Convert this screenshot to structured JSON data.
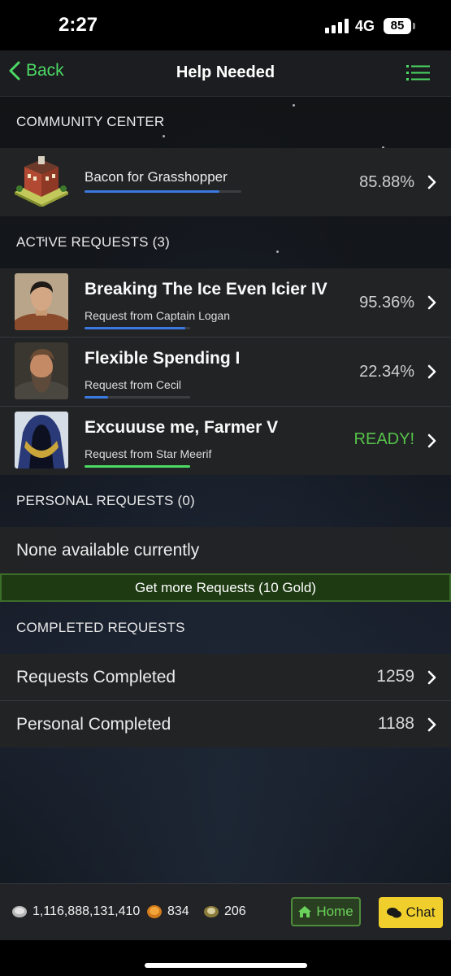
{
  "status_bar": {
    "time": "2:27",
    "network": "4G",
    "battery": "85"
  },
  "nav": {
    "back_label": "Back",
    "title": "Help Needed"
  },
  "community": {
    "section_label": "COMMUNITY CENTER",
    "name": "Bacon for Grasshopper",
    "percent": "85.88%",
    "progress": 0.859
  },
  "active": {
    "section_label": "ACTIVE REQUESTS (3)",
    "requests": [
      {
        "title": "Breaking The Ice Even Icier IV",
        "from": "Request from Captain Logan",
        "status": "95.36%",
        "progress": 0.954
      },
      {
        "title": "Flexible Spending I",
        "from": "Request from Cecil",
        "status": "22.34%",
        "progress": 0.223
      },
      {
        "title": "Excuuuse me, Farmer V",
        "from": "Request from Star Meerif",
        "status": "READY!",
        "progress": 1.0
      }
    ]
  },
  "personal": {
    "section_label": "PERSONAL REQUESTS (0)",
    "empty_text": "None available currently",
    "get_more_label": "Get more Requests (10 Gold)"
  },
  "completed": {
    "section_label": "COMPLETED REQUESTS",
    "rows": [
      {
        "label": "Requests Completed",
        "value": "1259"
      },
      {
        "label": "Personal Completed",
        "value": "1188"
      }
    ]
  },
  "footer": {
    "coins": "1,116,888,131,410",
    "gold": "834",
    "tokens": "206",
    "home_label": "Home",
    "chat_label": "Chat"
  },
  "colors": {
    "accent_green": "#4cd964",
    "progress_blue": "#3a79e0",
    "chat_yellow": "#f0cf2c"
  }
}
